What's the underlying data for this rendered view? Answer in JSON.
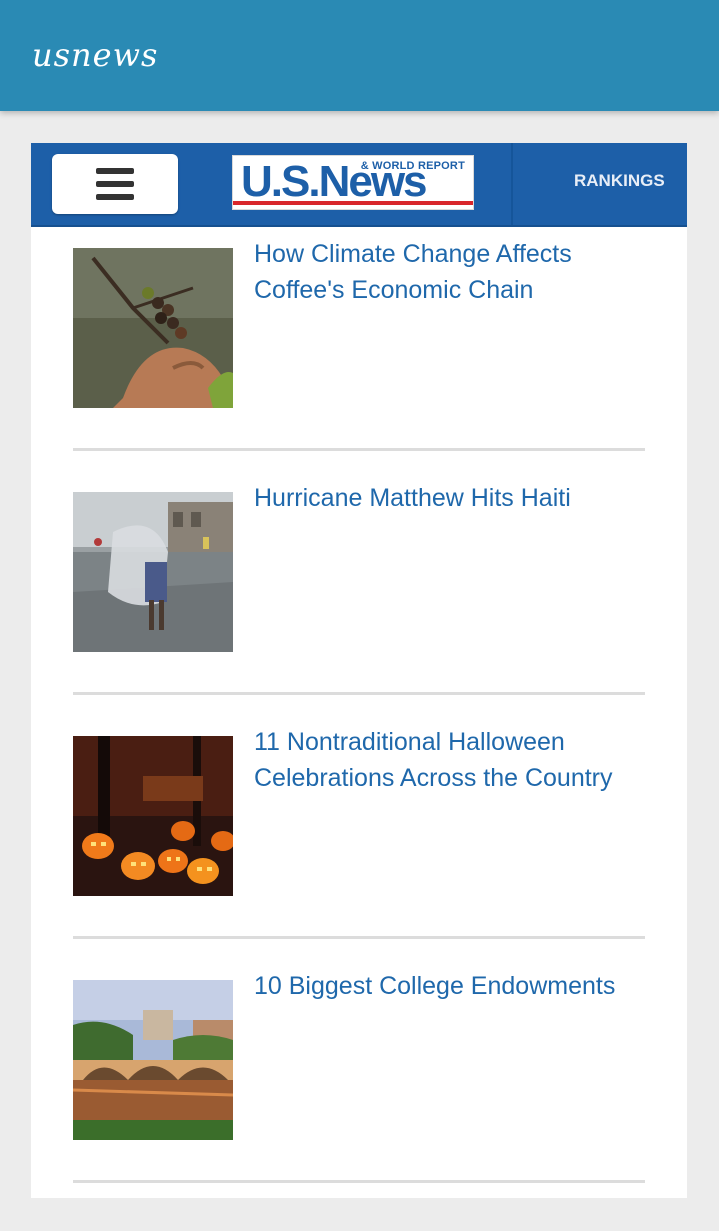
{
  "app": {
    "title": "usnews"
  },
  "site_header": {
    "logo_main": "U.S.News",
    "logo_sub": "& WORLD REPORT",
    "nav_link": "RANKINGS"
  },
  "articles": [
    {
      "title": "How Climate Change Affects Coffee's Economic Chain",
      "image": "coffee-beans-photo"
    },
    {
      "title": "Hurricane Matthew Hits Haiti",
      "image": "haiti-rain-photo"
    },
    {
      "title": "11 Nontraditional Halloween Celebrations Across the Country",
      "image": "jack-o-lanterns-photo"
    },
    {
      "title": "10 Biggest College Endowments",
      "image": "bridge-river-photo"
    }
  ],
  "colors": {
    "app_bar": "#2a8ab4",
    "site_header": "#1d5fa8",
    "headline": "#1f68ab",
    "logo_stripe": "#d8262b"
  }
}
